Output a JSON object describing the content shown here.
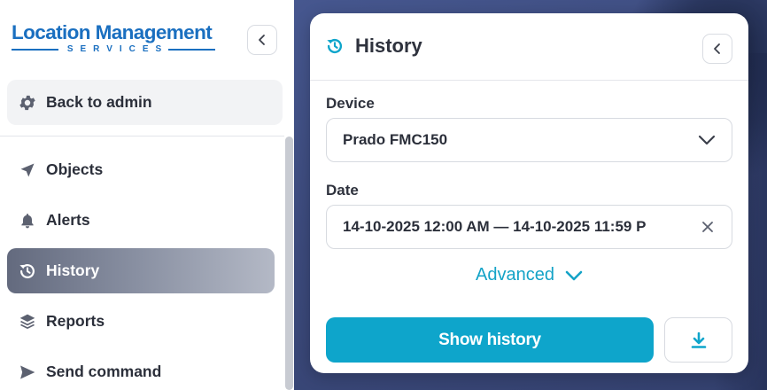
{
  "logo": {
    "title": "Location Management",
    "subtitle": "SERVICES",
    "color": "#1a6fc0"
  },
  "sidebar": {
    "collapse_icon": "chevron-left-icon",
    "back_admin": {
      "label": "Back to admin",
      "icon": "gear-icon"
    },
    "items": [
      {
        "label": "Objects",
        "icon": "navigation-arrow-icon",
        "active": false
      },
      {
        "label": "Alerts",
        "icon": "bell-icon",
        "active": false
      },
      {
        "label": "History",
        "icon": "history-clock-icon",
        "active": true
      },
      {
        "label": "Reports",
        "icon": "layers-icon",
        "active": false
      },
      {
        "label": "Send command",
        "icon": "send-icon",
        "active": false
      }
    ]
  },
  "panel": {
    "title": "History",
    "title_icon": "history-clock-icon",
    "collapse_icon": "chevron-left-icon",
    "device": {
      "label": "Device",
      "value": "Prado FMC150",
      "icon": "chevron-down-icon"
    },
    "date": {
      "label": "Date",
      "value": "14-10-2025 12:00 AM — 14-10-2025 11:59 P",
      "clear_icon": "close-icon"
    },
    "advanced": {
      "label": "Advanced",
      "icon": "chevron-down-icon"
    },
    "show_button": "Show history",
    "download_icon": "download-icon"
  },
  "colors": {
    "accent": "#0ea5cb",
    "link": "#14a3c7",
    "active_nav_start": "#636a7e",
    "active_nav_end": "#b4b9c6",
    "text": "#2b2f3a",
    "map_bg": "#3e4c7e"
  }
}
